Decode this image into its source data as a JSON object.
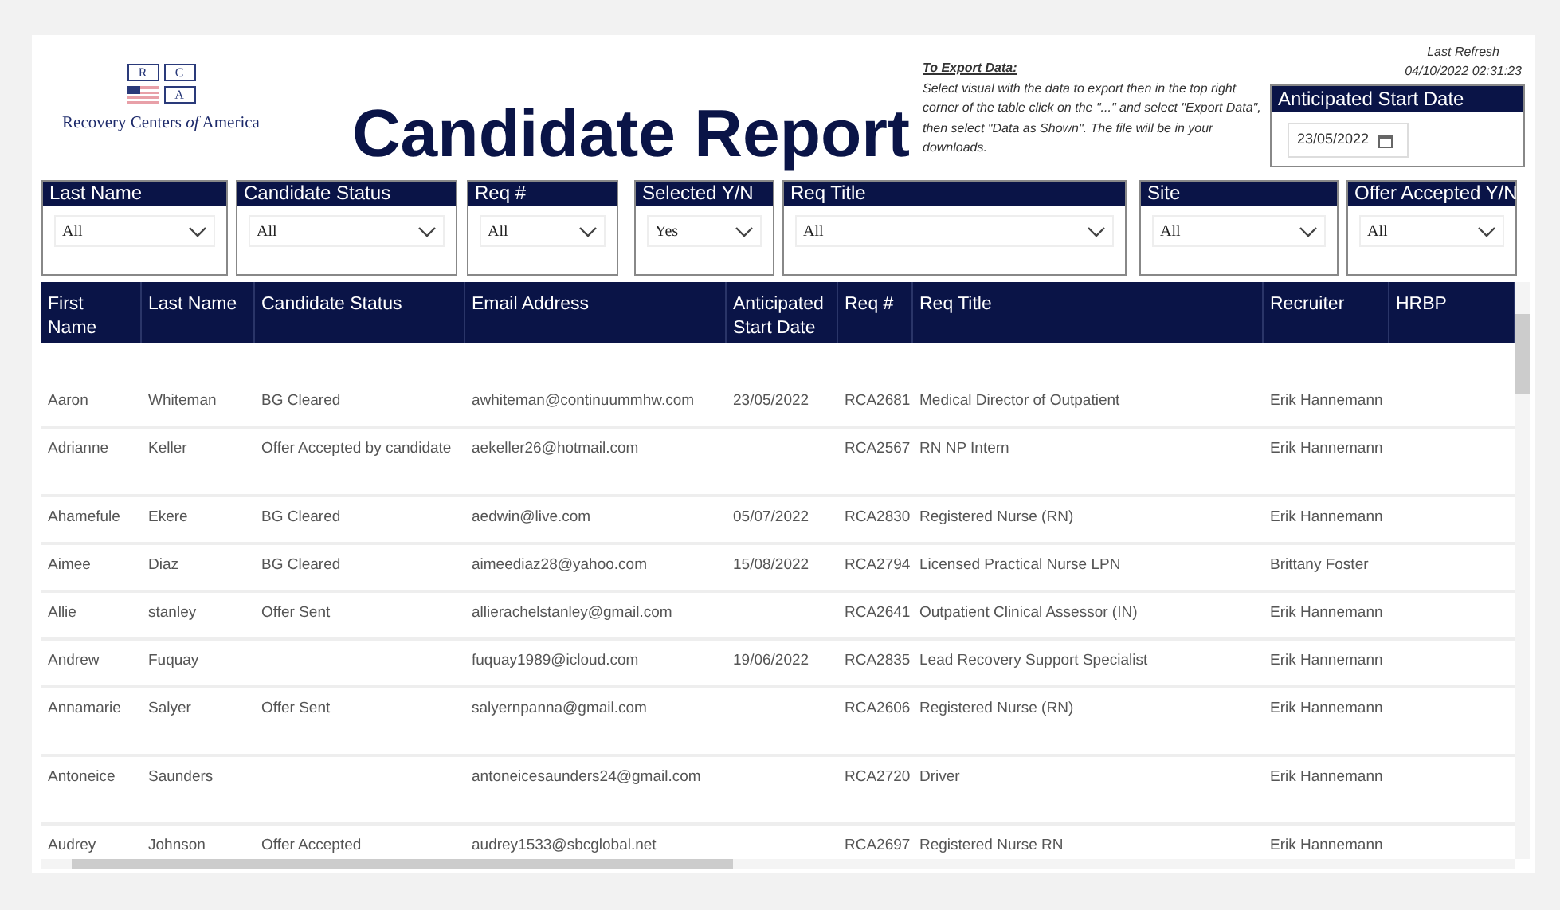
{
  "logo": {
    "letters": [
      "R",
      "C",
      "A"
    ],
    "name": "Recovery Centers ",
    "name_italic": "of",
    "name_end": " America"
  },
  "title": "Candidate Report",
  "export_note": {
    "heading": "To Export Data:",
    "text": "Select visual with the data to export then in the top right corner of the table click on the \"...\" and select \"Export Data\", then select \"Data as Shown\". The file will be in your downloads."
  },
  "last_refresh": {
    "label": "Last Refresh",
    "value": "04/10/2022 02:31:23"
  },
  "date_filter": {
    "label": "Anticipated Start Date",
    "value": "23/05/2022"
  },
  "filters": [
    {
      "label": "Last Name",
      "value": "All"
    },
    {
      "label": "Candidate Status",
      "value": "All"
    },
    {
      "label": "Req #",
      "value": "All"
    },
    {
      "label": "Selected Y/N",
      "value": "Yes"
    },
    {
      "label": "Req Title",
      "value": "All"
    },
    {
      "label": "Site",
      "value": "All"
    },
    {
      "label": "Offer Accepted Y/N",
      "value": "All"
    }
  ],
  "table": {
    "columns": [
      "First Name",
      "Last Name",
      "Candidate Status",
      "Email Address",
      "Anticipated Start Date",
      "Req #",
      "Req Title",
      "Recruiter",
      "HRBP"
    ],
    "rows": [
      [
        "Aaron",
        "Whiteman",
        "BG Cleared",
        "awhiteman@continuummhw.com",
        "23/05/2022",
        "RCA2681",
        "Medical Director of Outpatient",
        "Erik Hannemann",
        ""
      ],
      [
        "Adrianne",
        "Keller",
        "Offer Accepted by candidate",
        "aekeller26@hotmail.com",
        "",
        "RCA2567",
        "RN NP Intern",
        "Erik Hannemann",
        ""
      ],
      [
        "Ahamefule",
        "Ekere",
        "BG Cleared",
        "aedwin@live.com",
        "05/07/2022",
        "RCA2830",
        "Registered Nurse (RN)",
        "Erik Hannemann",
        ""
      ],
      [
        "Aimee",
        "Diaz",
        "BG Cleared",
        "aimeediaz28@yahoo.com",
        "15/08/2022",
        "RCA2794",
        "Licensed Practical Nurse LPN",
        "Brittany Foster",
        ""
      ],
      [
        "Allie",
        "stanley",
        "Offer Sent",
        "allierachelstanley@gmail.com",
        "",
        "RCA2641",
        "Outpatient Clinical Assessor (IN)",
        "Erik Hannemann",
        ""
      ],
      [
        "Andrew",
        "Fuquay",
        "",
        "fuquay1989@icloud.com",
        "19/06/2022",
        "RCA2835",
        "Lead Recovery Support Specialist",
        "Erik Hannemann",
        ""
      ],
      [
        "Annamarie",
        "Salyer",
        "Offer Sent",
        "salyernpanna@gmail.com",
        "",
        "RCA2606",
        "Registered Nurse (RN)",
        "Erik Hannemann",
        ""
      ],
      [
        "Antoneice",
        "Saunders",
        "",
        "antoneicesaunders24@gmail.com",
        "",
        "RCA2720",
        "Driver",
        "Erik Hannemann",
        ""
      ],
      [
        "Audrey",
        "Johnson",
        "Offer Accepted",
        "audrey1533@sbcglobal.net",
        "",
        "RCA2697",
        "Registered Nurse RN",
        "Erik Hannemann",
        ""
      ]
    ]
  }
}
